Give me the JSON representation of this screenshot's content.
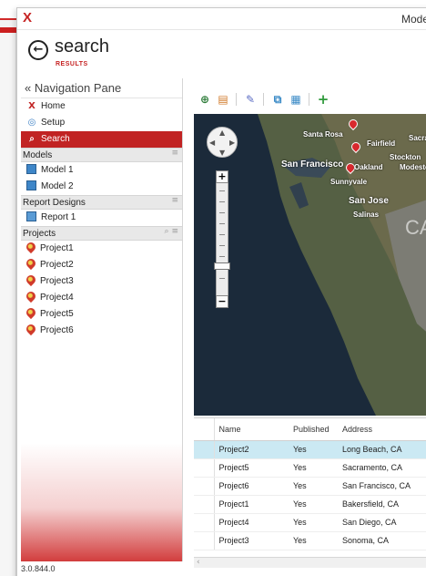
{
  "app": {
    "title": "Mode",
    "logo": "X"
  },
  "page": {
    "back_glyph": "←",
    "title": "search",
    "subtitle": "RESULTS"
  },
  "nav_pane": {
    "header": "« Navigation Pane",
    "items": [
      {
        "label": "Home",
        "icon": "home-icon",
        "glyph": "X",
        "active": false
      },
      {
        "label": "Setup",
        "icon": "gear-icon",
        "glyph": "◎",
        "active": false
      },
      {
        "label": "Search",
        "icon": "search-icon",
        "glyph": "⌕",
        "active": true
      }
    ],
    "sections": [
      {
        "title": "Models",
        "tools": "≡",
        "items": [
          "Model 1",
          "Model 2"
        ]
      },
      {
        "title": "Report Designs",
        "tools": "≡",
        "items": [
          "Report 1"
        ]
      },
      {
        "title": "Projects",
        "tools": "⌕ ≡",
        "items": [
          "Project1",
          "Project2",
          "Project3",
          "Project4",
          "Project5",
          "Project6"
        ]
      }
    ]
  },
  "toolbar": {
    "icons": [
      "map-zoom-icon",
      "layers-icon",
      "edit-icon",
      "export-icon",
      "table-icon",
      "add-icon"
    ]
  },
  "map": {
    "labels": {
      "santa_rosa": "Santa Rosa",
      "sacramento": "Sacramento",
      "fairfield": "Fairfield",
      "stockton": "Stockton",
      "san_francisco": "San Francisco",
      "oakland": "Oakland",
      "modesto": "Modesto",
      "sunnyvale": "Sunnyvale",
      "san_jose": "San Jose",
      "salinas": "Salinas",
      "state": "CAL"
    }
  },
  "grid": {
    "columns": [
      "Name",
      "Published",
      "Address"
    ],
    "rows": [
      {
        "name": "Project2",
        "published": "Yes",
        "address": "Long Beach, CA",
        "selected": true
      },
      {
        "name": "Project5",
        "published": "Yes",
        "address": "Sacramento, CA",
        "selected": false
      },
      {
        "name": "Project6",
        "published": "Yes",
        "address": "San Francisco, CA",
        "selected": false
      },
      {
        "name": "Project1",
        "published": "Yes",
        "address": "Bakersfield, CA",
        "selected": false
      },
      {
        "name": "Project4",
        "published": "Yes",
        "address": "San Diego, CA",
        "selected": false
      },
      {
        "name": "Project3",
        "published": "Yes",
        "address": "Sonoma, CA",
        "selected": false
      }
    ],
    "scroll_left_glyph": "‹"
  },
  "status": {
    "version": "3.0.844.0"
  },
  "colors": {
    "accent": "#c12323",
    "selected_row": "#cbe9f3"
  }
}
